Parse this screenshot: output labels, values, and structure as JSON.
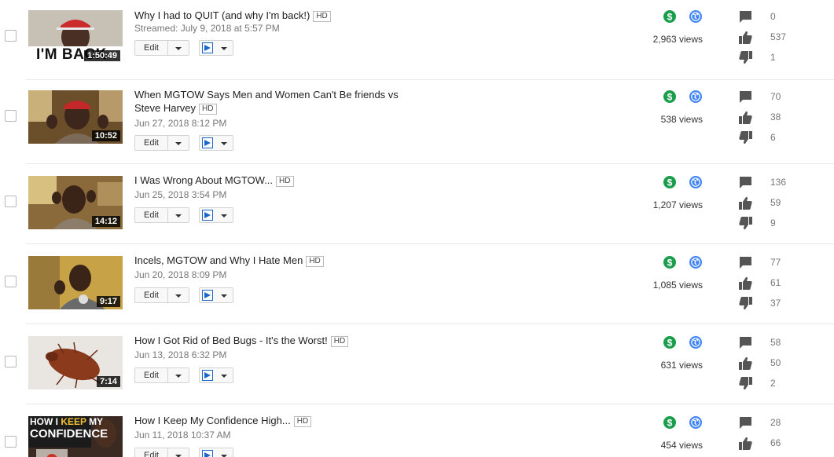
{
  "controls": {
    "edit_label": "Edit",
    "hd_badge": "HD"
  },
  "videos": [
    {
      "title": "Why I had to QUIT (and why I'm back!)",
      "title_line2": "",
      "date": "Streamed: July 9, 2018 at 5:57 PM",
      "duration": "1:50:49",
      "thumb_caption": "I'M BACK",
      "views": "2,963 views",
      "comments": "0",
      "likes": "537",
      "dislikes": "1"
    },
    {
      "title": "When MGTOW Says Men and Women Can't Be friends vs",
      "title_line2": "Steve Harvey",
      "date": "Jun 27, 2018 8:12 PM",
      "duration": "10:52",
      "views": "538 views",
      "comments": "70",
      "likes": "38",
      "dislikes": "6"
    },
    {
      "title": "I Was Wrong About MGTOW...",
      "title_line2": "",
      "date": "Jun 25, 2018 3:54 PM",
      "duration": "14:12",
      "views": "1,207 views",
      "comments": "136",
      "likes": "59",
      "dislikes": "9"
    },
    {
      "title": "Incels, MGTOW and Why I Hate Men",
      "title_line2": "",
      "date": "Jun 20, 2018 8:09 PM",
      "duration": "9:17",
      "views": "1,085 views",
      "comments": "77",
      "likes": "61",
      "dislikes": "37"
    },
    {
      "title": "How I Got Rid of Bed Bugs - It's the Worst!",
      "title_line2": "",
      "date": "Jun 13, 2018 6:32 PM",
      "duration": "7:14",
      "views": "631 views",
      "comments": "58",
      "likes": "50",
      "dislikes": "2"
    },
    {
      "title": "How I Keep My Confidence High...",
      "title_line2": "",
      "date": "Jun 11, 2018 10:37 AM",
      "duration": "",
      "thumb_caption_1": "HOW I",
      "thumb_caption_keep": "KEEP",
      "thumb_caption_my": "MY",
      "thumb_caption_2": "CONFIDENCE",
      "views": "454 views",
      "comments": "28",
      "likes": "66",
      "dislikes": ""
    }
  ],
  "colors": {
    "monetization_green": "#1a9e4b",
    "visibility_blue": "#4285f4",
    "icon_grey": "#555555"
  },
  "icons": {
    "monetization": "dollar-icon",
    "visibility": "globe-icon",
    "comments": "comment-icon",
    "likes": "thumbs-up-icon",
    "dislikes": "thumbs-down-icon"
  }
}
